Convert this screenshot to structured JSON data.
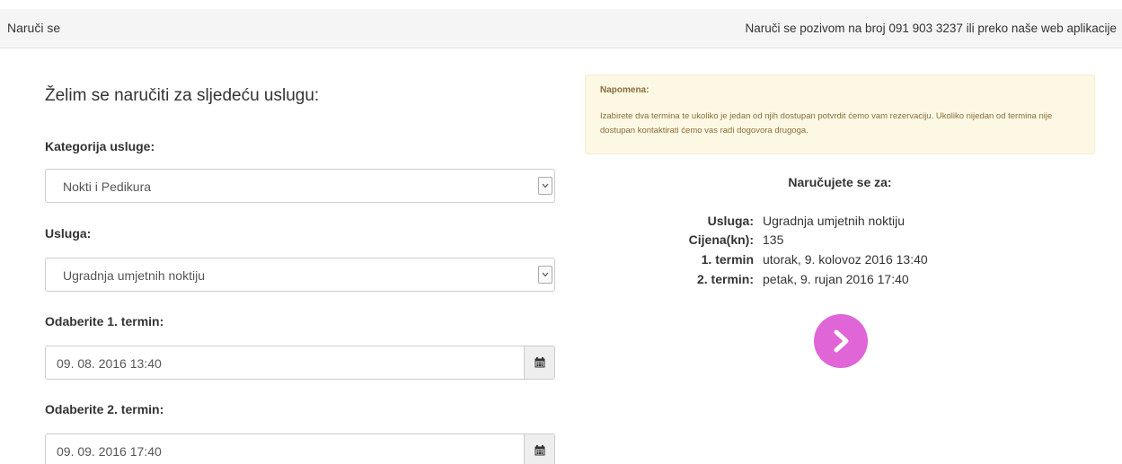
{
  "header": {
    "title": "Naruči se",
    "info": "Naruči se pozivom na broj 091 903 3237 ili preko naše web aplikacije"
  },
  "form": {
    "heading": "Želim se naručiti za sljedeću uslugu:",
    "category_label": "Kategorija usluge:",
    "category_value": "Nokti i Pedikura",
    "service_label": "Usluga:",
    "service_value": "Ugradnja umjetnih noktiju",
    "term1_label": "Odaberite 1. termin:",
    "term1_value": "09. 08. 2016 13:40",
    "term2_label": "Odaberite 2. termin:",
    "term2_value": "09. 09. 2016 17:40"
  },
  "notice": {
    "title": "Napomena:",
    "text": "Izabirete dva termina te ukoliko je jedan od njih dostupan potvrdit ćemo vam rezervaciju. Ukoliko nijedan od termina nije dostupan kontaktirati ćemo vas radi dogovora drugoga."
  },
  "summary": {
    "title": "Naručujete se za:",
    "rows": [
      {
        "label": "Usluga:",
        "value": "Ugradnja umjetnih noktiju"
      },
      {
        "label": "Cijena(kn):",
        "value": "135"
      },
      {
        "label": "1. termin",
        "value": "utorak, 9. kolovoz 2016 13:40"
      },
      {
        "label": "2. termin:",
        "value": "petak, 9. rujan 2016 17:40"
      }
    ]
  },
  "icons": {
    "select_arrow": "chevron-down-icon",
    "calendar": "calendar-icon",
    "next": "chevron-right-icon"
  },
  "colors": {
    "accent": "#e065d7",
    "notice_bg": "#fcf8e3",
    "notice_text": "#8a6d3b"
  }
}
